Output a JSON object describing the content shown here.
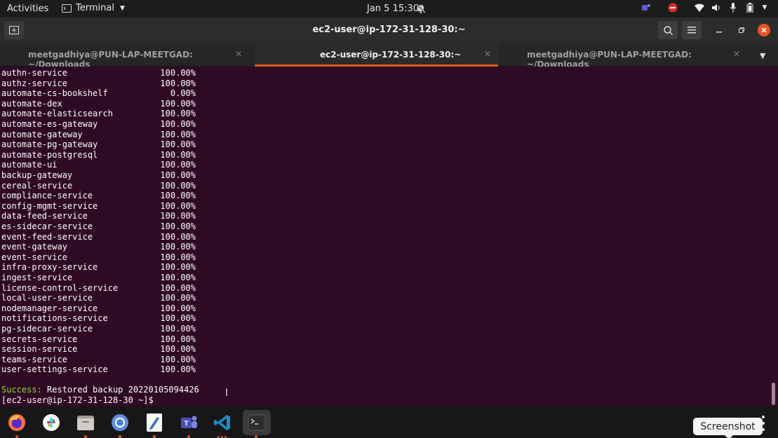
{
  "topbar": {
    "activities": "Activities",
    "app_name": "Terminal",
    "clock": "Jan 5  15:30"
  },
  "window": {
    "title": "ec2-user@ip-172-31-128-30:~"
  },
  "tabs": [
    {
      "label": "meetgadhiya@PUN-LAP-MEETGAD: ~/Downloads",
      "active": false
    },
    {
      "label": "ec2-user@ip-172-31-128-30:~",
      "active": true
    },
    {
      "label": "meetgadhiya@PUN-LAP-MEETGAD: ~/Downloads",
      "active": false
    }
  ],
  "terminal": {
    "rows": [
      {
        "service": "authn-service",
        "pct": "100.00%"
      },
      {
        "service": "authz-service",
        "pct": "100.00%"
      },
      {
        "service": "automate-cs-bookshelf",
        "pct": "0.00%"
      },
      {
        "service": "automate-dex",
        "pct": "100.00%"
      },
      {
        "service": "automate-elasticsearch",
        "pct": "100.00%"
      },
      {
        "service": "automate-es-gateway",
        "pct": "100.00%"
      },
      {
        "service": "automate-gateway",
        "pct": "100.00%"
      },
      {
        "service": "automate-pg-gateway",
        "pct": "100.00%"
      },
      {
        "service": "automate-postgresql",
        "pct": "100.00%"
      },
      {
        "service": "automate-ui",
        "pct": "100.00%"
      },
      {
        "service": "backup-gateway",
        "pct": "100.00%"
      },
      {
        "service": "cereal-service",
        "pct": "100.00%"
      },
      {
        "service": "compliance-service",
        "pct": "100.00%"
      },
      {
        "service": "config-mgmt-service",
        "pct": "100.00%"
      },
      {
        "service": "data-feed-service",
        "pct": "100.00%"
      },
      {
        "service": "es-sidecar-service",
        "pct": "100.00%"
      },
      {
        "service": "event-feed-service",
        "pct": "100.00%"
      },
      {
        "service": "event-gateway",
        "pct": "100.00%"
      },
      {
        "service": "event-service",
        "pct": "100.00%"
      },
      {
        "service": "infra-proxy-service",
        "pct": "100.00%"
      },
      {
        "service": "ingest-service",
        "pct": "100.00%"
      },
      {
        "service": "license-control-service",
        "pct": "100.00%"
      },
      {
        "service": "local-user-service",
        "pct": "100.00%"
      },
      {
        "service": "nodemanager-service",
        "pct": "100.00%"
      },
      {
        "service": "notifications-service",
        "pct": "100.00%"
      },
      {
        "service": "pg-sidecar-service",
        "pct": "100.00%"
      },
      {
        "service": "secrets-service",
        "pct": "100.00%"
      },
      {
        "service": "session-service",
        "pct": "100.00%"
      },
      {
        "service": "teams-service",
        "pct": "100.00%"
      },
      {
        "service": "user-settings-service",
        "pct": "100.00%"
      }
    ],
    "success_label": "Success:",
    "success_message": " Restored backup 20220105094426",
    "prompt": "[ec2-user@ip-172-31-128-30 ~]$"
  },
  "dock": {
    "items": [
      "firefox-icon",
      "slack-icon",
      "files-icon",
      "chromium-icon",
      "text-editor-icon",
      "teams-icon",
      "vscode-icon",
      "terminal-icon"
    ]
  },
  "tooltip": {
    "label": "Screenshot"
  },
  "colors": {
    "terminal_bg": "#300a24",
    "accent": "#e95420",
    "success": "#8ae234"
  }
}
